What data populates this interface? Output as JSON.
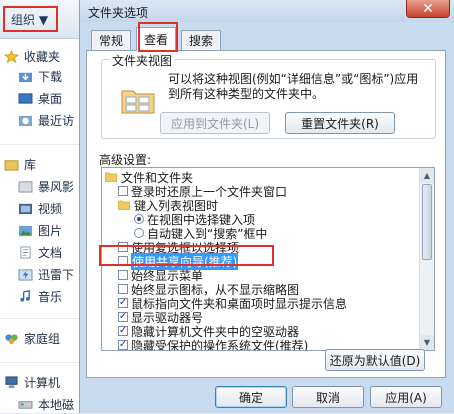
{
  "explorer": {
    "organize_label": "组织 ▼",
    "nav_items": [
      {
        "label": "收藏夹",
        "icon": "star-icon"
      },
      {
        "label": "下载",
        "icon": "download-folder-icon"
      },
      {
        "label": "桌面",
        "icon": "desktop-icon"
      },
      {
        "label": "最近访",
        "icon": "recent-places-icon"
      },
      {
        "label": "库",
        "icon": "library-icon"
      },
      {
        "label": "暴风影",
        "icon": "video-library-icon"
      },
      {
        "label": "视频",
        "icon": "video-icon"
      },
      {
        "label": "图片",
        "icon": "pictures-icon"
      },
      {
        "label": "文档",
        "icon": "documents-icon"
      },
      {
        "label": "迅雷下",
        "icon": "thunder-download-icon"
      },
      {
        "label": "音乐",
        "icon": "music-icon"
      },
      {
        "label": "家庭组",
        "icon": "homegroup-icon"
      },
      {
        "label": "计算机",
        "icon": "computer-icon"
      },
      {
        "label": "本地磁",
        "icon": "local-disk-icon"
      }
    ]
  },
  "dialog": {
    "title": "文件夹选项",
    "close_symbol": "✕",
    "tabs": [
      "常规",
      "查看",
      "搜索"
    ],
    "folder_view": {
      "title": "文件夹视图",
      "description": "可以将这种视图(例如“详细信息”或“图标”)应用到所有这种类型的文件夹中。",
      "apply_button": "应用到文件夹(L)",
      "reset_button": "重置文件夹(R)"
    },
    "advanced_label": "高级设置:",
    "tree_items": [
      {
        "kind": "folder",
        "label": "文件和文件夹",
        "indent": 0
      },
      {
        "kind": "checkbox",
        "checked": false,
        "label": "登录时还原上一个文件夹窗口",
        "indent": 1
      },
      {
        "kind": "folder",
        "label": "键入列表视图时",
        "indent": 1
      },
      {
        "kind": "radio",
        "checked": true,
        "label": "在视图中选择键入项",
        "indent": 2
      },
      {
        "kind": "radio",
        "checked": false,
        "label": "自动键入到“搜索”框中",
        "indent": 2
      },
      {
        "kind": "checkbox",
        "checked": false,
        "label": "使用复选框以选择项",
        "indent": 1
      },
      {
        "kind": "checkbox",
        "checked": false,
        "label": "使用共享向导(推荐)",
        "indent": 1,
        "selected": true
      },
      {
        "kind": "checkbox",
        "checked": false,
        "label": "始终显示菜单",
        "indent": 1
      },
      {
        "kind": "checkbox",
        "checked": false,
        "label": "始终显示图标，从不显示缩略图",
        "indent": 1
      },
      {
        "kind": "checkbox",
        "checked": true,
        "label": "鼠标指向文件夹和桌面项时显示提示信息",
        "indent": 1
      },
      {
        "kind": "checkbox",
        "checked": true,
        "label": "显示驱动器号",
        "indent": 1
      },
      {
        "kind": "checkbox",
        "checked": true,
        "label": "隐藏计算机文件夹中的空驱动器",
        "indent": 1
      },
      {
        "kind": "checkbox",
        "checked": true,
        "label": "隐藏受保护的操作系统文件(推荐)",
        "indent": 1
      }
    ],
    "restore_defaults_button": "还原为默认值(D)",
    "ok_button": "确定",
    "cancel_button": "取消",
    "apply_button": "应用(A)"
  },
  "colors": {
    "highlight_box": "#e0302a",
    "selection": "#3399ff"
  }
}
